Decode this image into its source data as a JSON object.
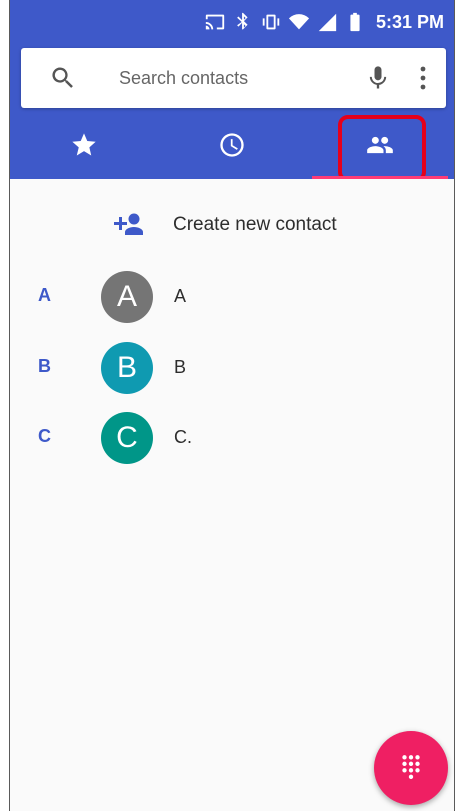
{
  "status_bar": {
    "time": "5:31 PM",
    "icons": [
      "cast-icon",
      "bluetooth-icon",
      "vibrate-icon",
      "wifi-icon",
      "signal-icon",
      "battery-icon"
    ]
  },
  "search": {
    "placeholder": "Search contacts",
    "value": ""
  },
  "tabs": [
    {
      "icon": "star-icon",
      "label": "Favorites",
      "active": false
    },
    {
      "icon": "clock-icon",
      "label": "Recents",
      "active": false
    },
    {
      "icon": "people-icon",
      "label": "Contacts",
      "active": true
    }
  ],
  "actions": {
    "create_contact_label": "Create new contact"
  },
  "contacts": [
    {
      "section": "A",
      "initial": "A",
      "name": "A",
      "avatar_color": "#757575"
    },
    {
      "section": "B",
      "initial": "B",
      "name": "B",
      "avatar_color": "#0f9ab1"
    },
    {
      "section": "C",
      "initial": "C",
      "name": "C.",
      "avatar_color": "#009688"
    }
  ],
  "colors": {
    "header": "#3e59c9",
    "tab_indicator": "#ff3c76",
    "highlight_box": "#e5001b",
    "fab": "#ef1f63",
    "section_letter": "#3e59c9"
  }
}
